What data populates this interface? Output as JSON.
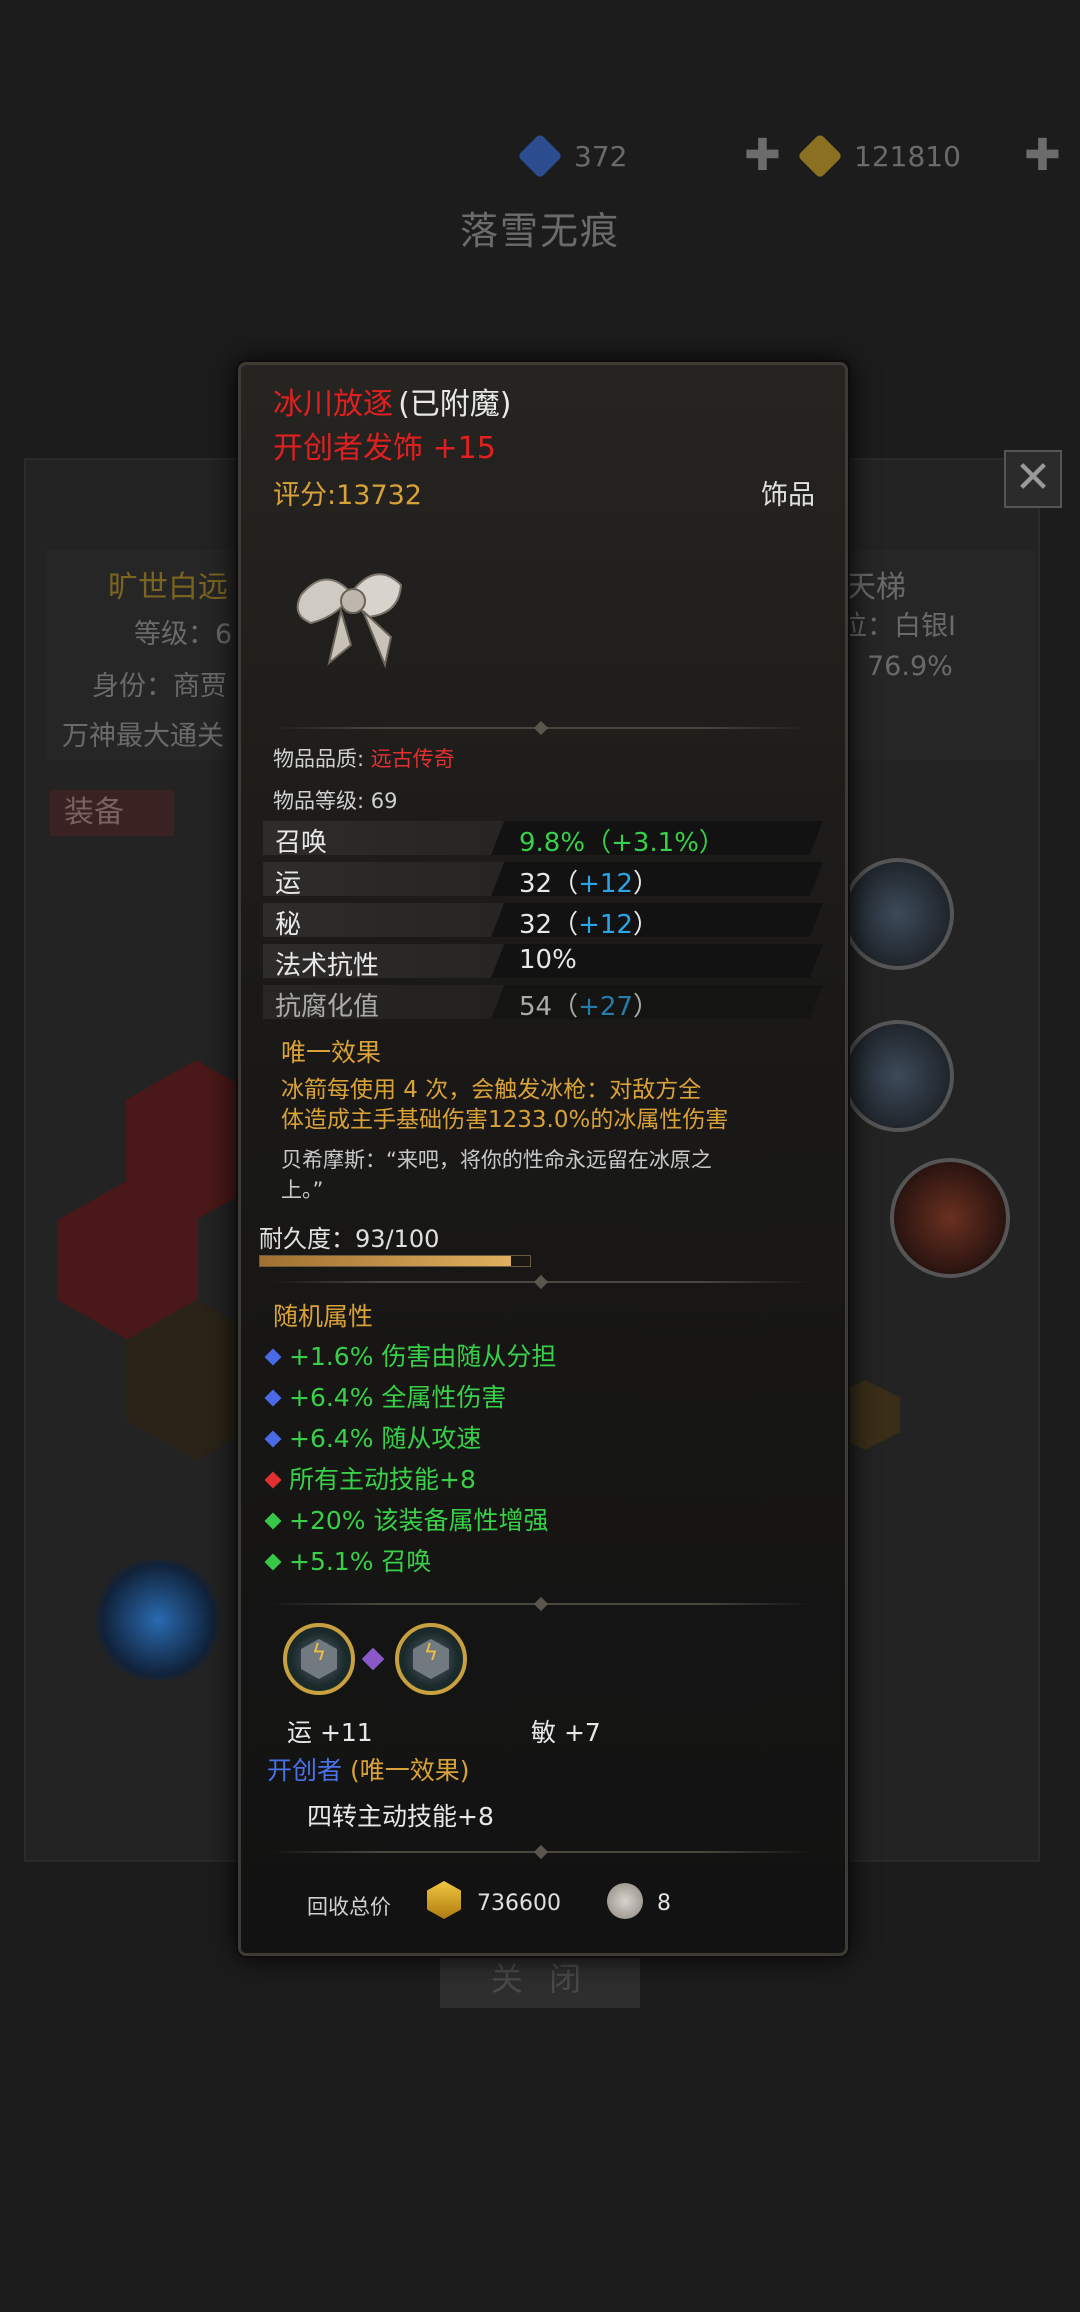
{
  "background": {
    "currency": [
      {
        "value": "372",
        "color": "#3a66c8",
        "icon": "blue-gem-icon"
      },
      {
        "value": "121810",
        "color": "#c8a030",
        "icon": "gold-coin-icon"
      }
    ],
    "character_name": "落雪无痕",
    "info": {
      "title_left": "旷世白远",
      "level_label": "等级：6",
      "identity_label": "身份：商贾",
      "extra_label": "万神最大通关",
      "title_right": "天梯",
      "rank_label": "位：白银I",
      "rate_label": "：76.9%"
    },
    "equip_tab": "装备",
    "close_button": "关 闭"
  },
  "tooltip": {
    "item_name": "冰川放逐",
    "enchant_suffix": "(已附魔)",
    "item_title": "开创者发饰 +15",
    "score": "评分:13732",
    "slot_type": "饰品",
    "quality_label": "物品品质:",
    "quality_value": "远古传奇",
    "item_level": "物品等级: 69",
    "stats": [
      {
        "name": "召唤",
        "value": "9.8%（+3.1%）",
        "base": "9.8%",
        "bonus": "（+3.1%）",
        "green": true
      },
      {
        "name": "运",
        "base": "32（",
        "bonus": "+12",
        "tail": "）"
      },
      {
        "name": "秘",
        "base": "32（",
        "bonus": "+12",
        "tail": "）"
      },
      {
        "name": "法术抗性",
        "base": "10%",
        "bonus": "",
        "tail": ""
      },
      {
        "name": "抗腐化值",
        "base": "54（",
        "bonus": "+27",
        "tail": "）"
      }
    ],
    "unique_title": "唯一效果",
    "unique_desc_1": "冰箭每使用 4 次，会触发冰枪：对敌方全",
    "unique_desc_2": "体造成主手基础伤害1233.0%的冰属性伤害",
    "quote_1": "贝希摩斯：“来吧，将你的性命永远留在冰原之",
    "quote_2": "上。”",
    "durability_label": "耐久度：93/100",
    "durability_value": 0.93,
    "random_title": "随机属性",
    "affixes": [
      {
        "text": "+1.6% 伤害由随从分担",
        "color": "#4a6ae8",
        "icon": "blue-diamond-icon"
      },
      {
        "text": "+6.4% 全属性伤害",
        "color": "#4a6ae8",
        "icon": "blue-diamond-icon"
      },
      {
        "text": "+6.4% 随从攻速",
        "color": "#4a6ae8",
        "icon": "blue-diamond-icon"
      },
      {
        "text": "所有主动技能+8",
        "color": "#e03030",
        "icon": "red-diamond-icon"
      },
      {
        "text": "+20% 该装备属性增强",
        "color": "#38c848",
        "icon": "green-diamond-icon"
      },
      {
        "text": "+5.1% 召唤",
        "color": "#38c848",
        "icon": "green-diamond-icon"
      }
    ],
    "socket_stat_1": "运  +11",
    "socket_stat_2": "敏  +7",
    "set_name": "开创者",
    "set_suffix": "(唯一效果)",
    "set_effect": "四转主动技能+8",
    "recycle_label": "回收总价",
    "recycle_gold": "736600",
    "recycle_shard": "8"
  }
}
